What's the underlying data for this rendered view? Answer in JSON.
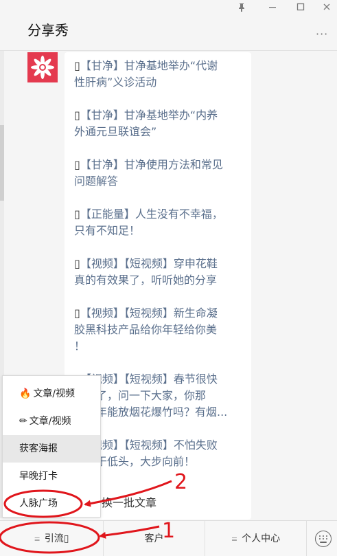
{
  "window": {
    "title": "分享秀",
    "controls": {
      "pin": "pin-icon",
      "minimize": "minimize-icon",
      "maximize": "maximize-icon",
      "close": "close-icon"
    },
    "more": "···"
  },
  "chat": {
    "avatar_icon": "flower-logo-icon",
    "articles": [
      {
        "glyph": "▯",
        "lines": [
          "【甘净】甘净基地举办“代谢",
          "性肝病”义诊活动"
        ]
      },
      {
        "glyph": "▯",
        "lines": [
          "【甘净】甘净基地举办“内养",
          "外通元旦联谊会”"
        ]
      },
      {
        "glyph": "▯",
        "lines": [
          "【甘净】甘净使用方法和常见",
          "问题解答"
        ]
      },
      {
        "glyph": "▯",
        "lines": [
          "【正能量】人生没有不幸福，",
          "只有不知足！"
        ]
      },
      {
        "glyph": "▯",
        "lines": [
          "【视频】【短视频】穿申花鞋",
          "真的有效果了，听听她的分享"
        ]
      },
      {
        "glyph": "▯",
        "lines": [
          "【视频】【短视频】新生命凝",
          "胶黑科技产品给你年轻给你美",
          "！"
        ]
      },
      {
        "glyph": "▯",
        "lines": [
          "【视频】【短视频】春节很快",
          "就到了，问一下大家，你那",
          "里今年能放烟花爆竹吗？有烟..."
        ]
      },
      {
        "glyph": "▯",
        "lines": [
          "【视频】【短视频】不怕失败",
          "，敢于低头，大步向前！"
        ]
      }
    ],
    "refresh_label": "换一批文章"
  },
  "popup_menu": {
    "items": [
      {
        "icon": "🔥",
        "label": "文章/视频",
        "active": false
      },
      {
        "icon": "✏",
        "label": "文章/视频",
        "active": false
      },
      {
        "icon": "",
        "label": "获客海报",
        "active": true
      },
      {
        "icon": "",
        "label": "早晚打卡",
        "active": false
      },
      {
        "icon": "",
        "label": "人脉广场",
        "active": false
      }
    ]
  },
  "bottom_menu": {
    "hamburger": "≡",
    "items": [
      {
        "label": "引流▯",
        "has_submenu": true
      },
      {
        "label": "客户",
        "has_submenu": false
      },
      {
        "label": "个人中心",
        "has_submenu": true
      }
    ],
    "keyboard_icon": "keyboard-icon"
  },
  "annotations": {
    "color": "#e0161c",
    "labels": [
      "2",
      "1"
    ]
  }
}
